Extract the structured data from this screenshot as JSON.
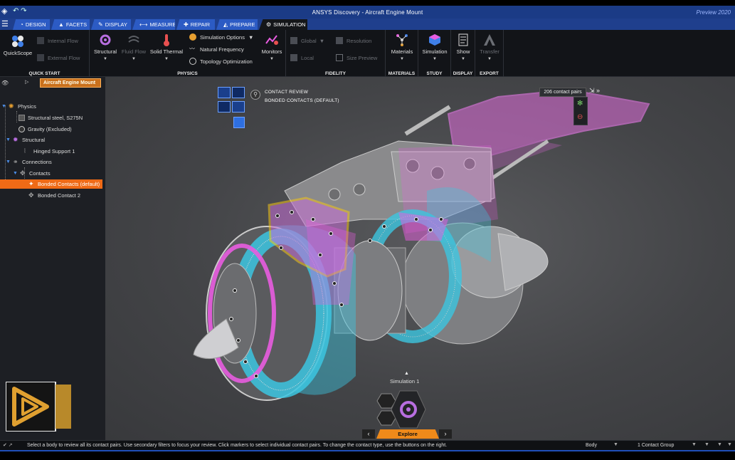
{
  "app": {
    "title": "ANSYS Discovery - Aircraft Engine Mount",
    "preview": "Preview 2020"
  },
  "tabs": [
    {
      "label": "Design",
      "icon": "design-icon"
    },
    {
      "label": "Facets",
      "icon": "facets-icon"
    },
    {
      "label": "Display",
      "icon": "display-icon"
    },
    {
      "label": "Measure",
      "icon": "measure-icon"
    },
    {
      "label": "Repair",
      "icon": "repair-icon"
    },
    {
      "label": "Prepare",
      "icon": "prepare-icon"
    },
    {
      "label": "Simulation",
      "icon": "simulation-icon",
      "active": true
    }
  ],
  "ribbon": {
    "quickstart": {
      "button": "QuickScope",
      "internal_flow": "Internal Flow",
      "external_flow": "External Flow",
      "group": "Quick Start"
    },
    "physics": {
      "structural": "Structural",
      "fluid_flow": "Fluid Flow",
      "solid_thermal": "Solid Thermal",
      "sim_options": "Simulation Options",
      "natural_frequency": "Natural Frequency",
      "topology_optimization": "Topology Optimization",
      "group": "Physics"
    },
    "monitors": {
      "label": "Monitors"
    },
    "fidelity": {
      "global": "Global",
      "local": "Local",
      "resolution": "Resolution",
      "size_preview": "Size Preview",
      "group": "Fidelity"
    },
    "materials": {
      "label": "Materials",
      "group": "Materials"
    },
    "study": {
      "label": "Simulation",
      "group": "Study"
    },
    "display": {
      "label": "Show",
      "group": "Display"
    },
    "export": {
      "label": "Transfer",
      "group": "Export"
    }
  },
  "tree": {
    "root": "Aircraft Engine Mount",
    "items": [
      {
        "label": "Physics"
      },
      {
        "label": "Structural steel, S275N"
      },
      {
        "label": "Gravity    (Excluded)"
      },
      {
        "label": "Structural"
      },
      {
        "label": "Hinged Support 1"
      },
      {
        "label": "Connections"
      },
      {
        "label": "Contacts"
      },
      {
        "label": "Bonded Contacts (default)"
      },
      {
        "label": "Bonded Contact 2"
      }
    ]
  },
  "viewport": {
    "contact_review": "Contact Review",
    "bonded_contacts": "Bonded Contacts (default)",
    "contact_pairs": "206 contact pairs",
    "hud_label": "Simulation 1",
    "explore": "Explore"
  },
  "status": {
    "message": "Select a body to review all its contact pairs. Use secondary filters to focus your review. Click markers to select individual contact pairs. To change the contact type, use the buttons on the right.",
    "selection": "Body",
    "group": "1 Contact Group"
  },
  "colors": {
    "accent": "#ef8a1a",
    "title_bar": "#1b3b86",
    "tab": "#2c5bc4",
    "contact_magenta": "#e85ce0",
    "contact_cyan": "#3cc6e0"
  }
}
